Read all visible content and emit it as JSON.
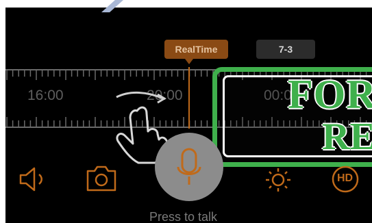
{
  "timeline": {
    "realtime_badge": "RealTime",
    "date_badge": "7-3",
    "labels": [
      "16:00",
      "20:00",
      "00:0"
    ]
  },
  "stamp": {
    "line1": "FOR",
    "line2": "RE"
  },
  "controls": {
    "press_to_talk": "Press to talk",
    "hd_label": "HD"
  },
  "icons": {
    "speaker": "speaker-icon",
    "camera": "camera-icon",
    "microphone": "microphone-icon",
    "brightness": "brightness-icon",
    "hd": "hd-icon",
    "hand": "hand-swipe-icon"
  },
  "colors": {
    "accent": "#c06a1a",
    "stamp": "#3fb04c"
  }
}
